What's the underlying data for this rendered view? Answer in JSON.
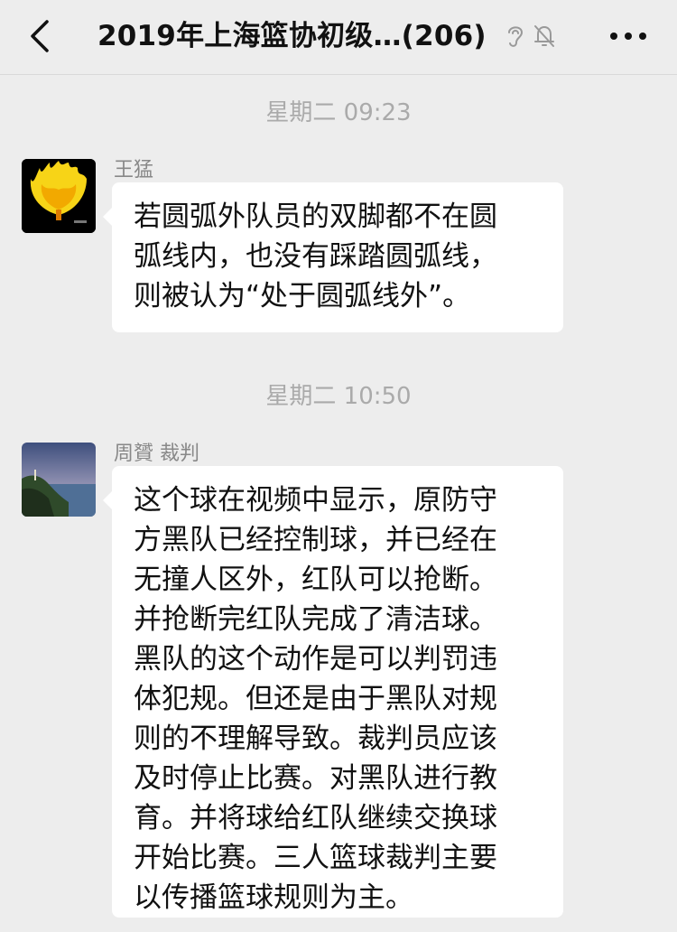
{
  "header": {
    "title": "2019年上海篮协初级…(206)"
  },
  "messages": [
    {
      "timestamp": "星期二 09:23",
      "sender": "王猛",
      "lines": [
        "若圆弧外队员的双脚都不在圆",
        "弧线内，也没有踩踏圆弧线，",
        "则被认为“处于圆弧线外”。"
      ]
    },
    {
      "timestamp": "星期二 10:50",
      "sender": "周贇 裁判",
      "lines": [
        "这个球在视频中显示，原防守",
        "方黑队已经控制球，并已经在",
        "无撞人区外，红队可以抢断。",
        "并抢断完红队完成了清洁球。",
        "黑队的这个动作是可以判罚违",
        "体犯规。但还是由于黑队对规",
        "则的不理解导致。裁判员应该",
        "及时停止比赛。对黑队进行教",
        "育。并将球给红队继续交换球",
        "开始比赛。三人篮球裁判主要",
        "以传播篮球规则为主。"
      ]
    }
  ],
  "icons": {
    "back": "chevron-left-icon",
    "ear": "ear-icon",
    "mute": "bell-slash-icon",
    "more": "more-dots-icon"
  },
  "colors": {
    "background": "#ededed",
    "bubble": "#ffffff",
    "timestamp": "#aaaaaa",
    "sender": "#888888"
  }
}
